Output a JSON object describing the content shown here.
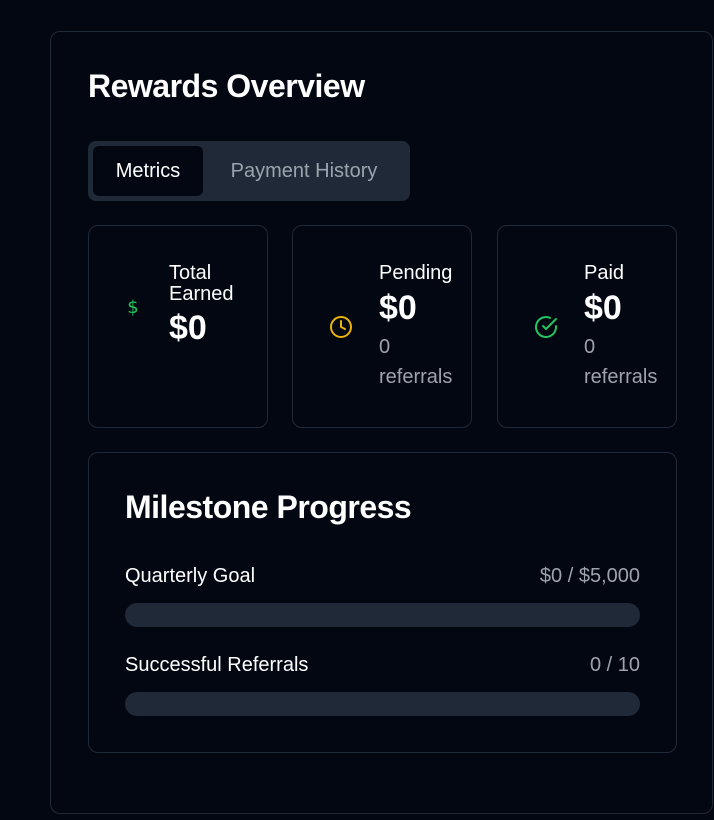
{
  "page": {
    "title": "Rewards Overview"
  },
  "tabs": [
    {
      "label": "Metrics",
      "active": true
    },
    {
      "label": "Payment History",
      "active": false
    }
  ],
  "stats": [
    {
      "label": "Total Earned",
      "amount": "$0",
      "sub": "",
      "icon": "dollar-icon",
      "icon_color": "#22c55e"
    },
    {
      "label": "Pending",
      "amount": "$0",
      "sub": "0 referrals",
      "icon": "clock-icon",
      "icon_color": "#eab308"
    },
    {
      "label": "Paid",
      "amount": "$0",
      "sub": "0 referrals",
      "icon": "check-circle-icon",
      "icon_color": "#22c55e"
    }
  ],
  "milestones": {
    "title": "Milestone Progress",
    "items": [
      {
        "label": "Quarterly Goal",
        "value": "$0 / $5,000",
        "progress": 0
      },
      {
        "label": "Successful Referrals",
        "value": "0 / 10",
        "progress": 0
      }
    ]
  },
  "colors": {
    "background": "#030712",
    "border": "#1f2937",
    "muted_text": "#9ca3af",
    "success": "#22c55e",
    "warning": "#eab308"
  }
}
